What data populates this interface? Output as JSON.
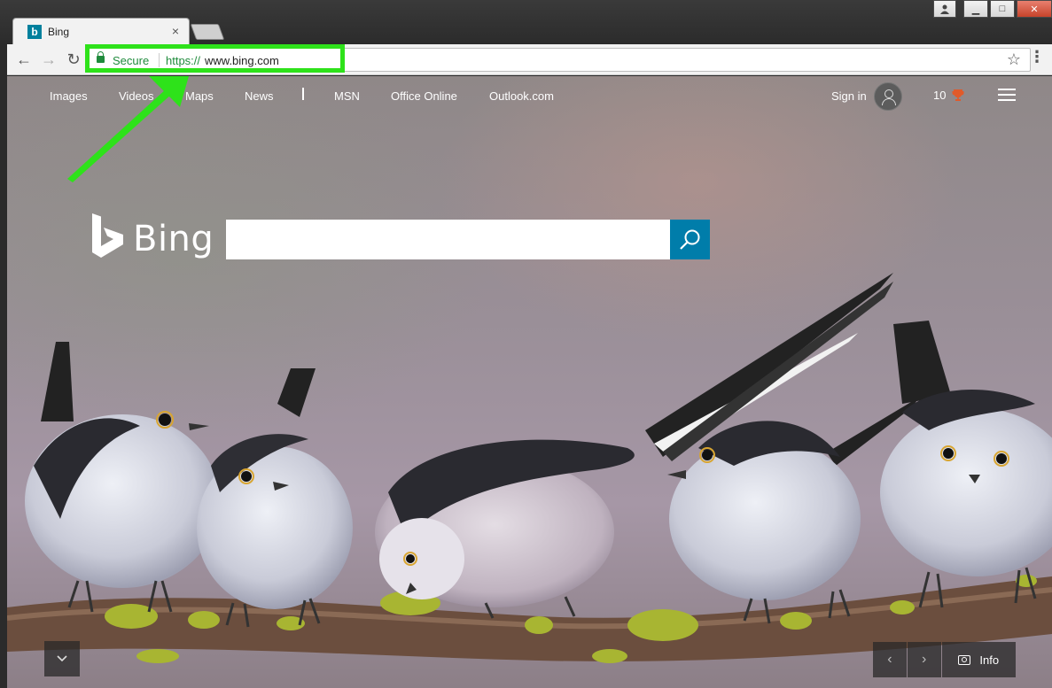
{
  "tab": {
    "title": "Bing",
    "close": "×",
    "favicon": "b"
  },
  "window_controls": {
    "user": "user-icon",
    "minimize": "▁",
    "maximize": "□",
    "close": "✕"
  },
  "toolbar": {
    "back": "←",
    "forward": "→",
    "reload": "↻",
    "secure_label": "Secure",
    "url_scheme": "https://",
    "url_host": "www.bing.com",
    "star": "☆",
    "menu": "⋮"
  },
  "nav": {
    "links": [
      "Images",
      "Videos",
      "Maps",
      "News",
      "MSN",
      "Office Online",
      "Outlook.com"
    ],
    "signin": "Sign in",
    "rewards_count": "10"
  },
  "logo": {
    "text": "Bing"
  },
  "search": {
    "value": "",
    "placeholder": ""
  },
  "bottom": {
    "info_label": "Info",
    "prev": "‹",
    "next": "›",
    "down": "⌄"
  },
  "colors": {
    "accent": "#007daa",
    "highlight": "#2ee21a",
    "secure": "#1f8b3c",
    "rewards": "#e05a2a"
  }
}
